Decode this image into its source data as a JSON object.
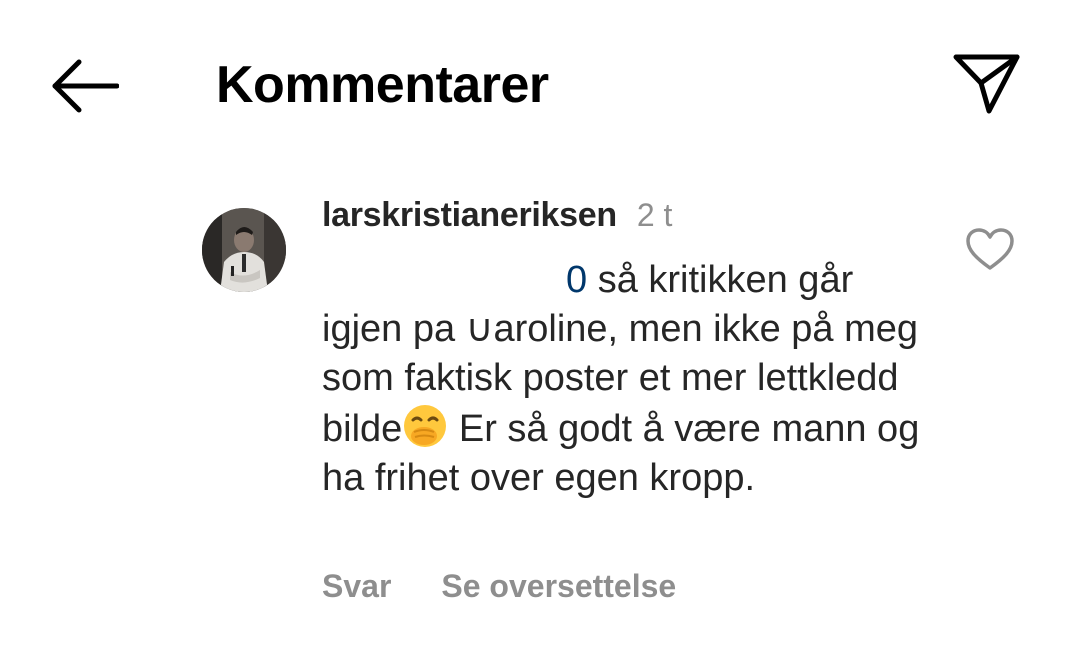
{
  "header": {
    "back_icon": "arrow-left-icon",
    "title": "Kommentarer",
    "share_icon": "paper-plane-icon"
  },
  "comment": {
    "avatar_icon": "user-avatar",
    "username": "larskristianeriksen",
    "time": "2 t",
    "mention": "0",
    "text_part1": " så kritikken går igjen pa ∪aroline, men ikke på meg som faktisk poster et mer lettkledd bilde",
    "emoji_icon": "face-with-hand-over-mouth-icon",
    "text_part2": " Er så godt å være mann og ha frihet over egen kropp.",
    "like_icon": "heart-outline-icon",
    "reply_label": "Svar",
    "translate_label": "Se oversettelse"
  },
  "colors": {
    "text_primary": "#262626",
    "text_secondary": "#8e8e8e",
    "mention": "#00376b",
    "emoji": "#ffc83d"
  }
}
